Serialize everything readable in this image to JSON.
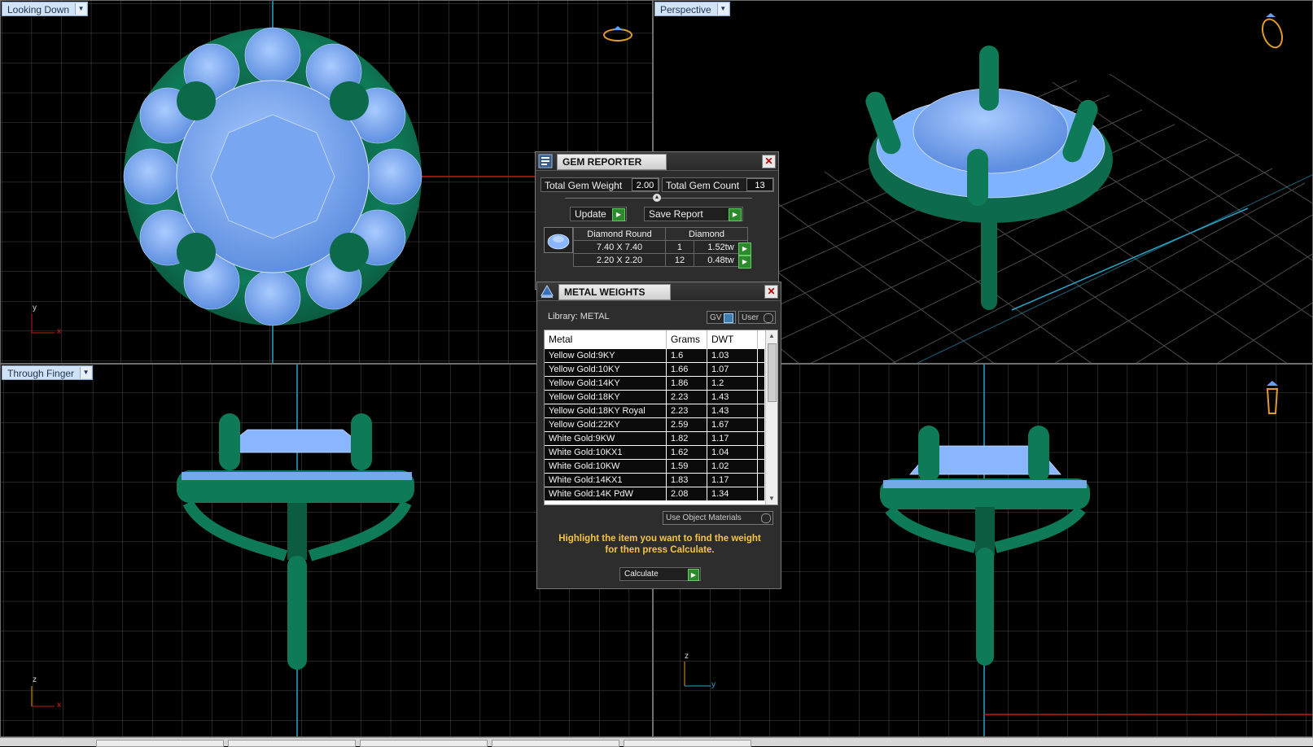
{
  "viewports": [
    {
      "label": "Looking Down",
      "name": "viewport-top",
      "axis": [
        "y",
        "x"
      ]
    },
    {
      "label": "Perspective",
      "name": "viewport-perspective"
    },
    {
      "label": "Through Finger",
      "name": "viewport-front",
      "axis": [
        "z",
        "x"
      ]
    },
    {
      "name": "viewport-side",
      "axis": [
        "z",
        "y"
      ]
    }
  ],
  "gem_reporter": {
    "title": "GEM REPORTER",
    "total_weight_label": "Total Gem Weight",
    "total_weight": "2.00",
    "total_count_label": "Total Gem Count",
    "total_count": "13",
    "update_label": "Update",
    "save_label": "Save Report",
    "header": {
      "shape": "Diamond Round",
      "material": "Diamond"
    },
    "rows": [
      {
        "size": "7.40 X 7.40",
        "count": "1",
        "weight": "1.52tw"
      },
      {
        "size": "2.20 X 2.20",
        "count": "12",
        "weight": "0.48tw"
      }
    ]
  },
  "metal_weights": {
    "title": "METAL WEIGHTS",
    "library_label": "Library: METAL",
    "gv_label": "GV",
    "user_label": "User",
    "columns": [
      "Metal",
      "Grams",
      "DWT"
    ],
    "rows": [
      [
        "Yellow Gold:9KY",
        "1.6",
        "1.03"
      ],
      [
        "Yellow Gold:10KY",
        "1.66",
        "1.07"
      ],
      [
        "Yellow Gold:14KY",
        "1.86",
        "1.2"
      ],
      [
        "Yellow Gold:18KY",
        "2.23",
        "1.43"
      ],
      [
        "Yellow Gold:18KY Royal",
        "2.23",
        "1.43"
      ],
      [
        "Yellow Gold:22KY",
        "2.59",
        "1.67"
      ],
      [
        "White Gold:9KW",
        "1.82",
        "1.17"
      ],
      [
        "White Gold:10KX1",
        "1.62",
        "1.04"
      ],
      [
        "White Gold:10KW",
        "1.59",
        "1.02"
      ],
      [
        "White Gold:14KX1",
        "1.83",
        "1.17"
      ],
      [
        "White Gold:14K PdW",
        "2.08",
        "1.34"
      ]
    ],
    "use_object_materials": "Use Object Materials",
    "hint": "Highlight the item you want to find the weight for then press Calculate.",
    "calculate_label": "Calculate"
  },
  "colors": {
    "metal": "#0f6e50",
    "gem": "#7fb2ff",
    "grid": "#4b4b4b",
    "axis": "#2aa6c8",
    "accent": "#f5c542"
  }
}
